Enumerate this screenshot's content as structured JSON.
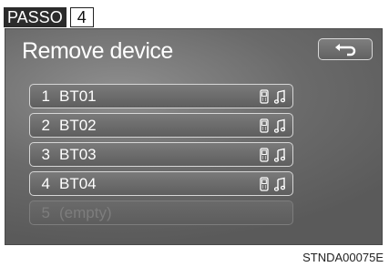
{
  "header": {
    "step_word": "PASSO",
    "step_number": "4"
  },
  "screen": {
    "title": "Remove device",
    "back_icon": "return-arrow-icon",
    "devices": [
      {
        "number": "1",
        "name": "BT01",
        "icons": [
          "phone-icon",
          "music-note-icon"
        ],
        "enabled": true
      },
      {
        "number": "2",
        "name": "BT02",
        "icons": [
          "phone-icon",
          "music-note-icon"
        ],
        "enabled": true
      },
      {
        "number": "3",
        "name": "BT03",
        "icons": [
          "phone-icon",
          "music-note-icon"
        ],
        "enabled": true
      },
      {
        "number": "4",
        "name": "BT04",
        "icons": [
          "phone-icon",
          "music-note-icon"
        ],
        "enabled": true
      },
      {
        "number": "5",
        "name": "(empty)",
        "icons": [],
        "enabled": false
      }
    ]
  },
  "footer": {
    "code": "STNDA00075E"
  },
  "colors": {
    "screen_bg": "#6a6a6a",
    "button_border": "#d6d6d6",
    "text": "#ffffff",
    "disabled_text": "#7d7d7d"
  }
}
